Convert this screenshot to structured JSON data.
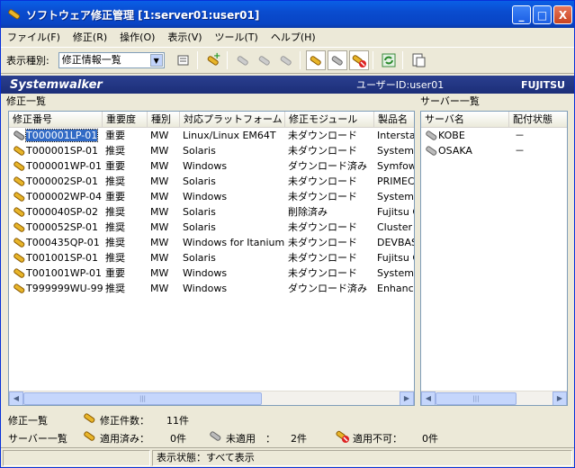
{
  "window": {
    "title": "ソフトウェア修正管理 [1:server01:user01]",
    "min": "_",
    "max": "□",
    "close": "X"
  },
  "menu": [
    "ファイル(F)",
    "修正(R)",
    "操作(O)",
    "表示(V)",
    "ツール(T)",
    "ヘルプ(H)"
  ],
  "toolbar": {
    "display_label": "表示種別:",
    "display_value": "修正情報一覧"
  },
  "banner": {
    "product": "Systemwalker",
    "user": "ユーザーID:user01",
    "brand": "FUJITSU"
  },
  "fix_list": {
    "label": "修正一覧",
    "columns": [
      "修正番号",
      "重要度",
      "種別",
      "対応プラットフォーム",
      "修正モジュール",
      "製品名"
    ],
    "rows": [
      {
        "id": "T000001LP-01",
        "sev": "重要",
        "type": "MW",
        "platform": "Linux/Linux EM64T",
        "module": "未ダウンロード",
        "product": "Interstag",
        "icon": "gray",
        "selected": true
      },
      {
        "id": "T000001SP-01",
        "sev": "推奨",
        "type": "MW",
        "platform": "Solaris",
        "module": "未ダウンロード",
        "product": "Systemw",
        "icon": "gold"
      },
      {
        "id": "T000001WP-01",
        "sev": "重要",
        "type": "MW",
        "platform": "Windows",
        "module": "ダウンロード済み",
        "product": "Symfowa",
        "icon": "gold"
      },
      {
        "id": "T000002SP-01",
        "sev": "推奨",
        "type": "MW",
        "platform": "Solaris",
        "module": "未ダウンロード",
        "product": "PRIMEC",
        "icon": "gold"
      },
      {
        "id": "T000002WP-04",
        "sev": "重要",
        "type": "MW",
        "platform": "Windows",
        "module": "未ダウンロード",
        "product": "Systemw",
        "icon": "gold"
      },
      {
        "id": "T000040SP-02",
        "sev": "推奨",
        "type": "MW",
        "platform": "Solaris",
        "module": "削除済み",
        "product": "Fujitsu C",
        "icon": "gold"
      },
      {
        "id": "T000052SP-01",
        "sev": "推奨",
        "type": "MW",
        "platform": "Solaris",
        "module": "未ダウンロード",
        "product": "Cluster",
        "icon": "gold"
      },
      {
        "id": "T000435QP-01",
        "sev": "推奨",
        "type": "MW",
        "platform": "Windows for Itanium",
        "module": "未ダウンロード",
        "product": "DEVBAS",
        "icon": "gold"
      },
      {
        "id": "T001001SP-01",
        "sev": "推奨",
        "type": "MW",
        "platform": "Solaris",
        "module": "未ダウンロード",
        "product": "Fujitsu C",
        "icon": "gold"
      },
      {
        "id": "T001001WP-01",
        "sev": "重要",
        "type": "MW",
        "platform": "Windows",
        "module": "未ダウンロード",
        "product": "SystemW",
        "icon": "gold"
      },
      {
        "id": "T999999WU-99",
        "sev": "推奨",
        "type": "MW",
        "platform": "Windows",
        "module": "ダウンロード済み",
        "product": "Enhance",
        "icon": "gold"
      }
    ]
  },
  "server_list": {
    "label": "サーバー一覧",
    "columns": [
      "サーバ名",
      "配付状態"
    ],
    "rows": [
      {
        "name": "KOBE",
        "state": "－"
      },
      {
        "name": "OSAKA",
        "state": "－"
      }
    ]
  },
  "summary": {
    "fix_label": "修正一覧",
    "fix_count_label": "修正件数：",
    "fix_count": "11件",
    "server_label": "サーバー一覧",
    "applied_label": "適用済み：",
    "applied": "0件",
    "unapplied_label": "未適用　：",
    "unapplied": "2件",
    "notapplicable_label": "適用不可：",
    "notapplicable": "0件"
  },
  "statusbar": {
    "text": "表示状態：すべて表示"
  },
  "colors": {
    "title": "#0a4ccf",
    "banner": "#1c2e78",
    "selection": "#316ac5"
  }
}
